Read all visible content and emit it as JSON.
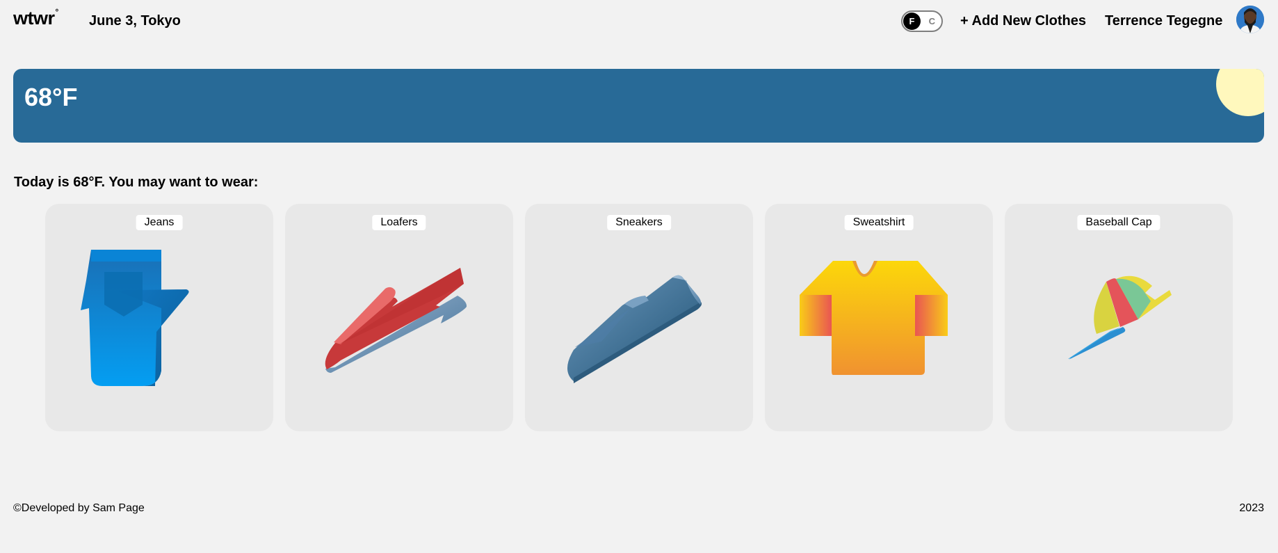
{
  "header": {
    "logo_text": "wtwr",
    "logo_mark": "°",
    "date_location": "June 3, Tokyo",
    "unit_toggle": {
      "active": "F",
      "inactive": "C"
    },
    "add_clothes_label": "+ Add New Clothes",
    "username": "Terrence Tegegne"
  },
  "weather": {
    "temperature": "68°F",
    "condition_icon": "sun-icon",
    "banner_color": "#286a97"
  },
  "recommendation": {
    "text": "Today is 68°F. You may want to wear:",
    "items": [
      {
        "label": "Jeans",
        "icon": "jeans-icon"
      },
      {
        "label": "Loafers",
        "icon": "loafers-icon"
      },
      {
        "label": "Sneakers",
        "icon": "sneakers-icon"
      },
      {
        "label": "Sweatshirt",
        "icon": "sweatshirt-icon"
      },
      {
        "label": "Baseball Cap",
        "icon": "baseball-cap-icon"
      }
    ]
  },
  "footer": {
    "credit": "©Developed by Sam Page",
    "year": "2023"
  }
}
